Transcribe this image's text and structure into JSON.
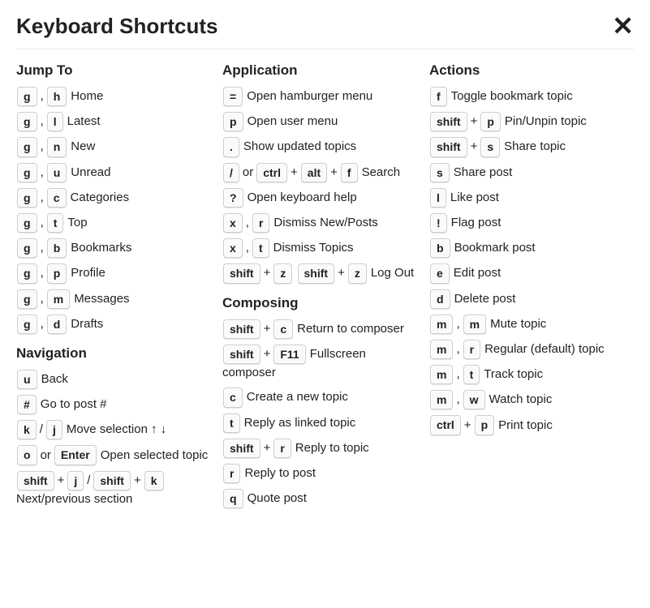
{
  "title": "Keyboard Shortcuts",
  "sections": {
    "jumpTo": {
      "title": "Jump To",
      "items": {
        "home": "Home",
        "latest": "Latest",
        "new": "New",
        "unread": "Unread",
        "categories": "Categories",
        "top": "Top",
        "bookmarks": "Bookmarks",
        "profile": "Profile",
        "messages": "Messages",
        "drafts": "Drafts"
      }
    },
    "navigation": {
      "title": "Navigation",
      "items": {
        "back": "Back",
        "gotoPost": "Go to post #",
        "moveSel": "Move selection ↑ ↓",
        "openSel": "Open selected topic",
        "nextPrev": "Next/previous section"
      }
    },
    "application": {
      "title": "Application",
      "items": {
        "hamburger": "Open hamburger menu",
        "userMenu": "Open user menu",
        "updated": "Show updated topics",
        "search": "Search",
        "keyboardHelp": "Open keyboard help",
        "dismissNewPosts": "Dismiss New/Posts",
        "dismissTopics": "Dismiss Topics",
        "logOut": "Log Out"
      }
    },
    "composing": {
      "title": "Composing",
      "items": {
        "returnComposer": "Return to composer",
        "fullscreen": "Fullscreen composer",
        "createTopic": "Create a new topic",
        "replyLinked": "Reply as linked topic",
        "replyTopic": "Reply to topic",
        "replyPost": "Reply to post",
        "quotePost": "Quote post"
      }
    },
    "actions": {
      "title": "Actions",
      "items": {
        "toggleBookmark": "Toggle bookmark topic",
        "pinUnpin": "Pin/Unpin topic",
        "shareTopic": "Share topic",
        "sharePost": "Share post",
        "likePost": "Like post",
        "flagPost": "Flag post",
        "bookmarkPost": "Bookmark post",
        "editPost": "Edit post",
        "deletePost": "Delete post",
        "muteTopic": "Mute topic",
        "regularTopic": "Regular (default) topic",
        "trackTopic": "Track topic",
        "watchTopic": "Watch topic",
        "printTopic": "Print topic"
      }
    }
  },
  "keys": {
    "g": "g",
    "h": "h",
    "l": "l",
    "n": "n",
    "u": "u",
    "c": "c",
    "t": "t",
    "b": "b",
    "p": "p",
    "m": "m",
    "d": "d",
    "r": "r",
    "s": "s",
    "e": "e",
    "w": "w",
    "x": "x",
    "z": "z",
    "j": "j",
    "k": "k",
    "o": "o",
    "q": "q",
    "f": "f",
    "hash": "#",
    "slash": "/",
    "dot": ".",
    "question": "?",
    "equals": "=",
    "bang": "!",
    "shift": "shift",
    "ctrl": "ctrl",
    "alt": "alt",
    "enter": "Enter",
    "f11": "F11"
  },
  "sep": {
    "comma": ",",
    "plus": "+",
    "slash": "/",
    "or": "or"
  }
}
